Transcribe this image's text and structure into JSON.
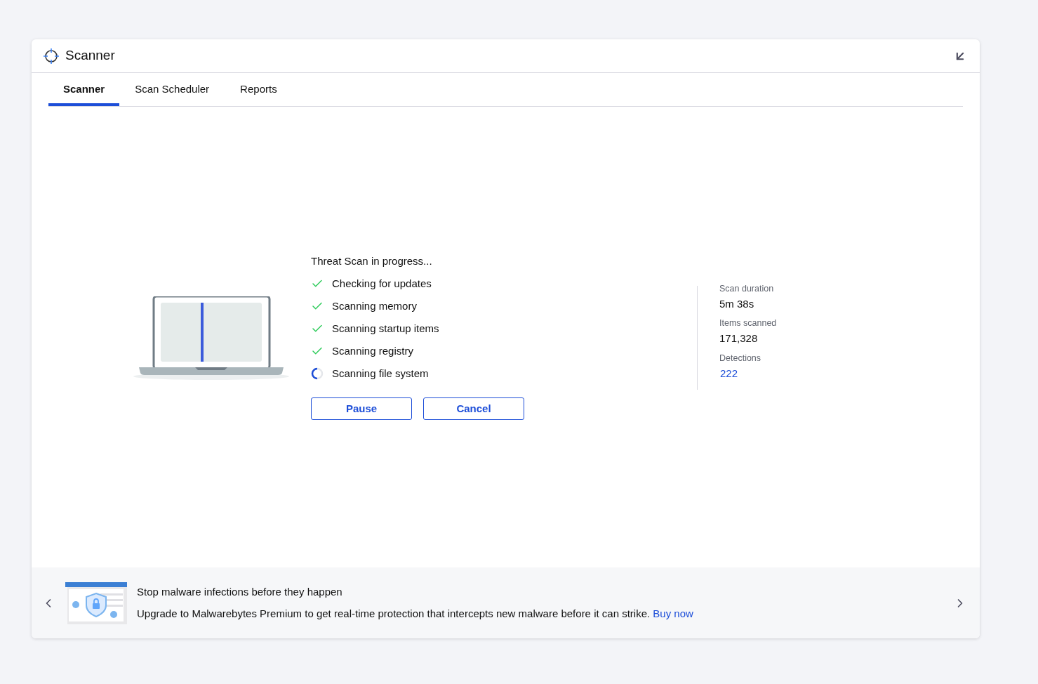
{
  "window": {
    "title": "Scanner"
  },
  "tabs": [
    {
      "label": "Scanner",
      "selected": true
    },
    {
      "label": "Scan Scheduler",
      "selected": false
    },
    {
      "label": "Reports",
      "selected": false
    }
  ],
  "scan": {
    "heading": "Threat Scan in progress...",
    "steps": [
      {
        "label": "Checking for updates",
        "kind": "done"
      },
      {
        "label": "Scanning memory",
        "kind": "done"
      },
      {
        "label": "Scanning startup items",
        "kind": "done"
      },
      {
        "label": "Scanning registry",
        "kind": "done"
      },
      {
        "label": "Scanning file system",
        "kind": "running"
      }
    ],
    "buttons": [
      "Pause",
      "Cancel"
    ]
  },
  "stats": [
    {
      "label": "Scan duration",
      "value": "5m 38s",
      "kind": "plain"
    },
    {
      "label": "Items scanned",
      "value": "171,328",
      "kind": "plain"
    },
    {
      "label": "Detections",
      "value": "222",
      "kind": "link"
    }
  ],
  "promo": {
    "title": "Stop malware infections before they happen",
    "text": "Upgrade to Malwarebytes Premium to get real-time protection that intercepts new malware before it can strike.",
    "link": "Buy now"
  }
}
